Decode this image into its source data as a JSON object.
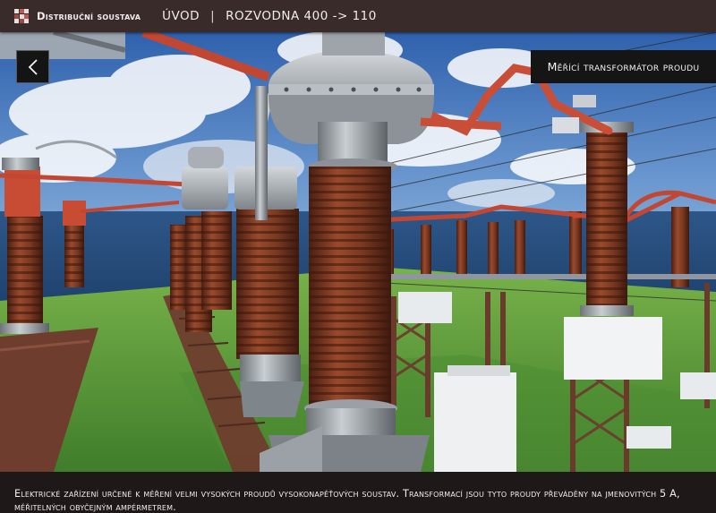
{
  "header": {
    "app_title": "Distribuční soustava",
    "crumb_home": "ÚVOD",
    "crumb_separator": "|",
    "crumb_current": "ROZVODNA 400 -> 110"
  },
  "panel": {
    "title": "Měřící transformátor proudu"
  },
  "navigation": {
    "back_icon": "chevron-left-icon"
  },
  "caption": {
    "text": "Elektrické zařízení určené k měření velmi vysokých proudů vysokonapěťových soustav. Transformací jsou tyto proudy převáděny na jmenovitých 5 A, měřitelných obyčejným ampérmetrem."
  },
  "colors": {
    "header_bg": "#3a2b2b",
    "caption_bg": "#1f1818",
    "insulator": "#7a3a22",
    "conductor": "#c8503a",
    "grass": "#5d9a3a",
    "sky": "#3f6fb4"
  }
}
